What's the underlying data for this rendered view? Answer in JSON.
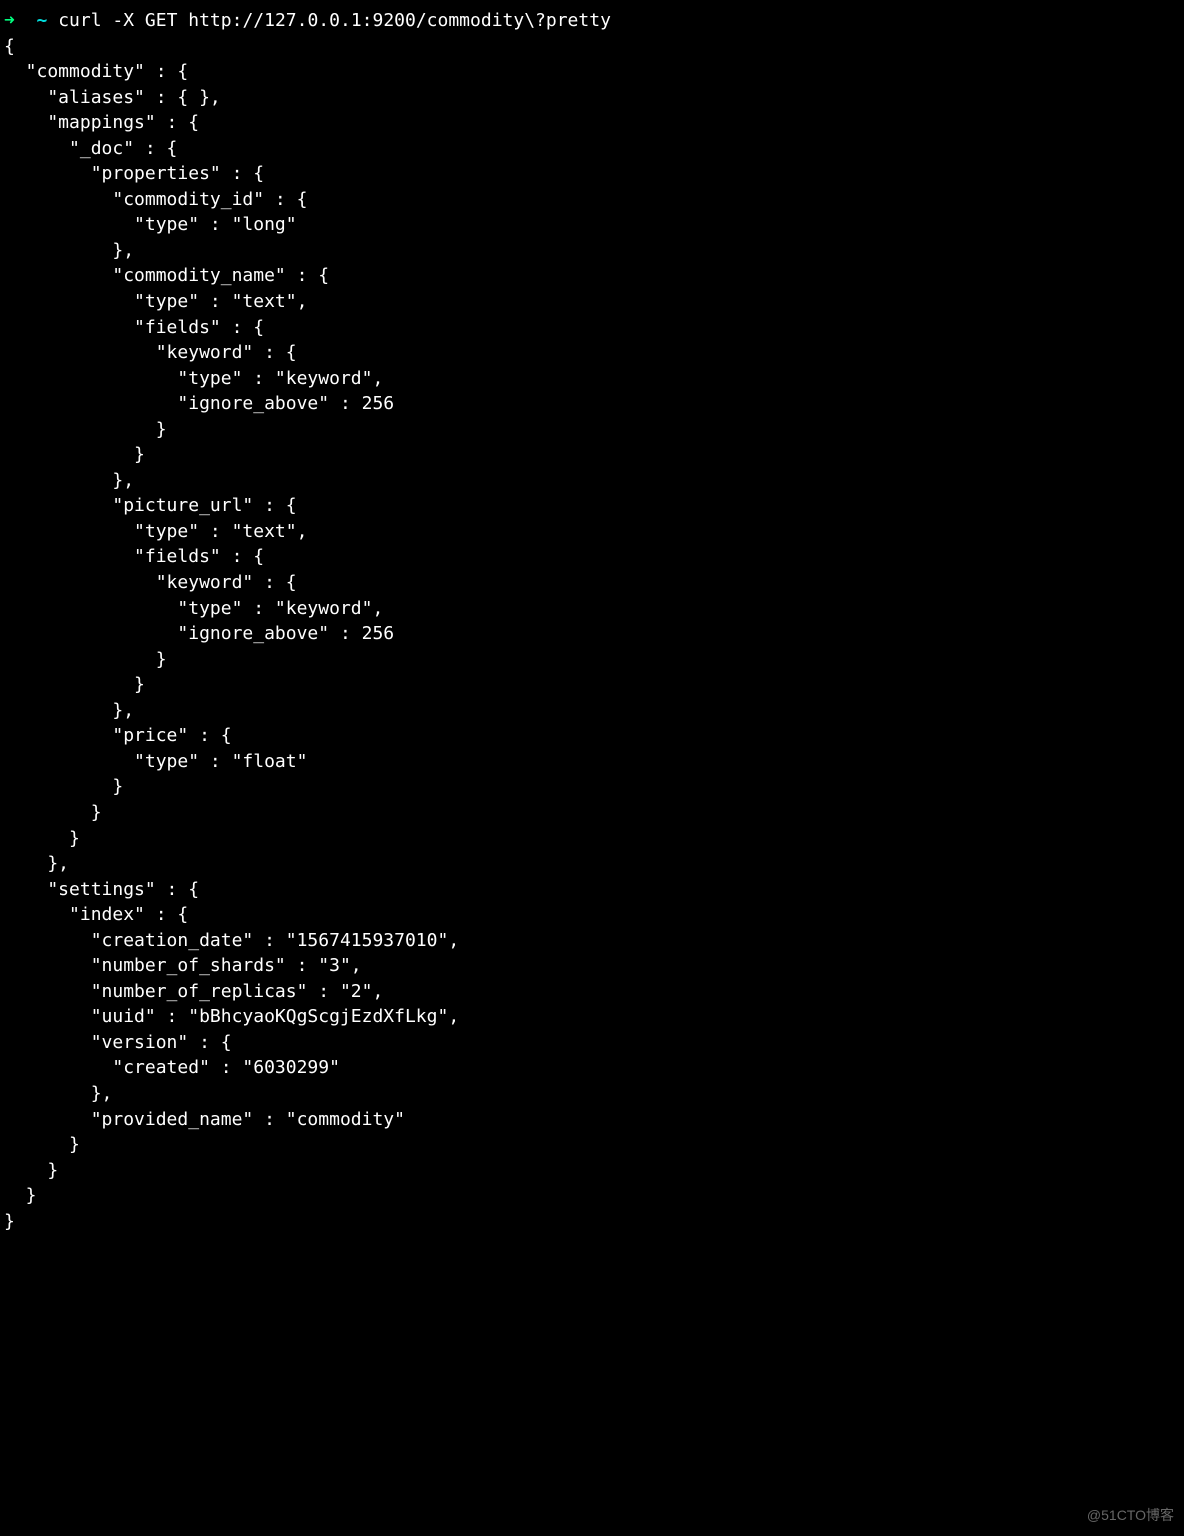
{
  "prompt": {
    "arrow": "➜",
    "tilde": "~",
    "command": "curl -X GET http://127.0.0.1:9200/commodity\\?pretty"
  },
  "output_lines": [
    "{",
    "  \"commodity\" : {",
    "    \"aliases\" : { },",
    "    \"mappings\" : {",
    "      \"_doc\" : {",
    "        \"properties\" : {",
    "          \"commodity_id\" : {",
    "            \"type\" : \"long\"",
    "          },",
    "          \"commodity_name\" : {",
    "            \"type\" : \"text\",",
    "            \"fields\" : {",
    "              \"keyword\" : {",
    "                \"type\" : \"keyword\",",
    "                \"ignore_above\" : 256",
    "              }",
    "            }",
    "          },",
    "          \"picture_url\" : {",
    "            \"type\" : \"text\",",
    "            \"fields\" : {",
    "              \"keyword\" : {",
    "                \"type\" : \"keyword\",",
    "                \"ignore_above\" : 256",
    "              }",
    "            }",
    "          },",
    "          \"price\" : {",
    "            \"type\" : \"float\"",
    "          }",
    "        }",
    "      }",
    "    },",
    "    \"settings\" : {",
    "      \"index\" : {",
    "        \"creation_date\" : \"1567415937010\",",
    "        \"number_of_shards\" : \"3\",",
    "        \"number_of_replicas\" : \"2\",",
    "        \"uuid\" : \"bBhcyaoKQgScgjEzdXfLkg\",",
    "        \"version\" : {",
    "          \"created\" : \"6030299\"",
    "        },",
    "        \"provided_name\" : \"commodity\"",
    "      }",
    "    }",
    "  }",
    "}"
  ],
  "watermark": "@51CTO博客"
}
